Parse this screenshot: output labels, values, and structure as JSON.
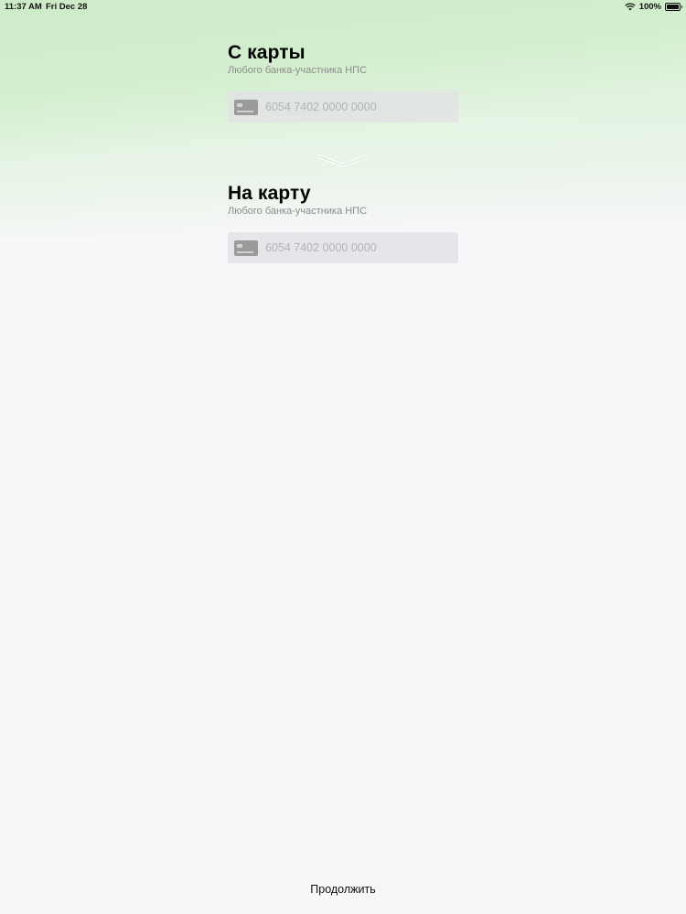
{
  "status_bar": {
    "time": "11:37 AM",
    "date": "Fri Dec 28",
    "battery": "100%"
  },
  "from_section": {
    "title": "С карты",
    "subtitle": "Любого банка-участника НПС",
    "card_placeholder": "6054 7402 0000 0000"
  },
  "to_section": {
    "title": "На карту",
    "subtitle": "Любого банка-участника НПС",
    "card_placeholder": "6054 7402 0000 0000"
  },
  "footer": {
    "continue_label": "Продолжить"
  },
  "icons": {
    "card": "credit-card-icon",
    "swap": "chevron-down-icon",
    "wifi": "wifi-icon",
    "battery": "battery-icon"
  },
  "colors": {
    "header_green": "#cdebc8",
    "background": "#f8f7fa",
    "subtitle_gray": "#8c8c8c",
    "placeholder_gray": "#b3b3b8"
  }
}
